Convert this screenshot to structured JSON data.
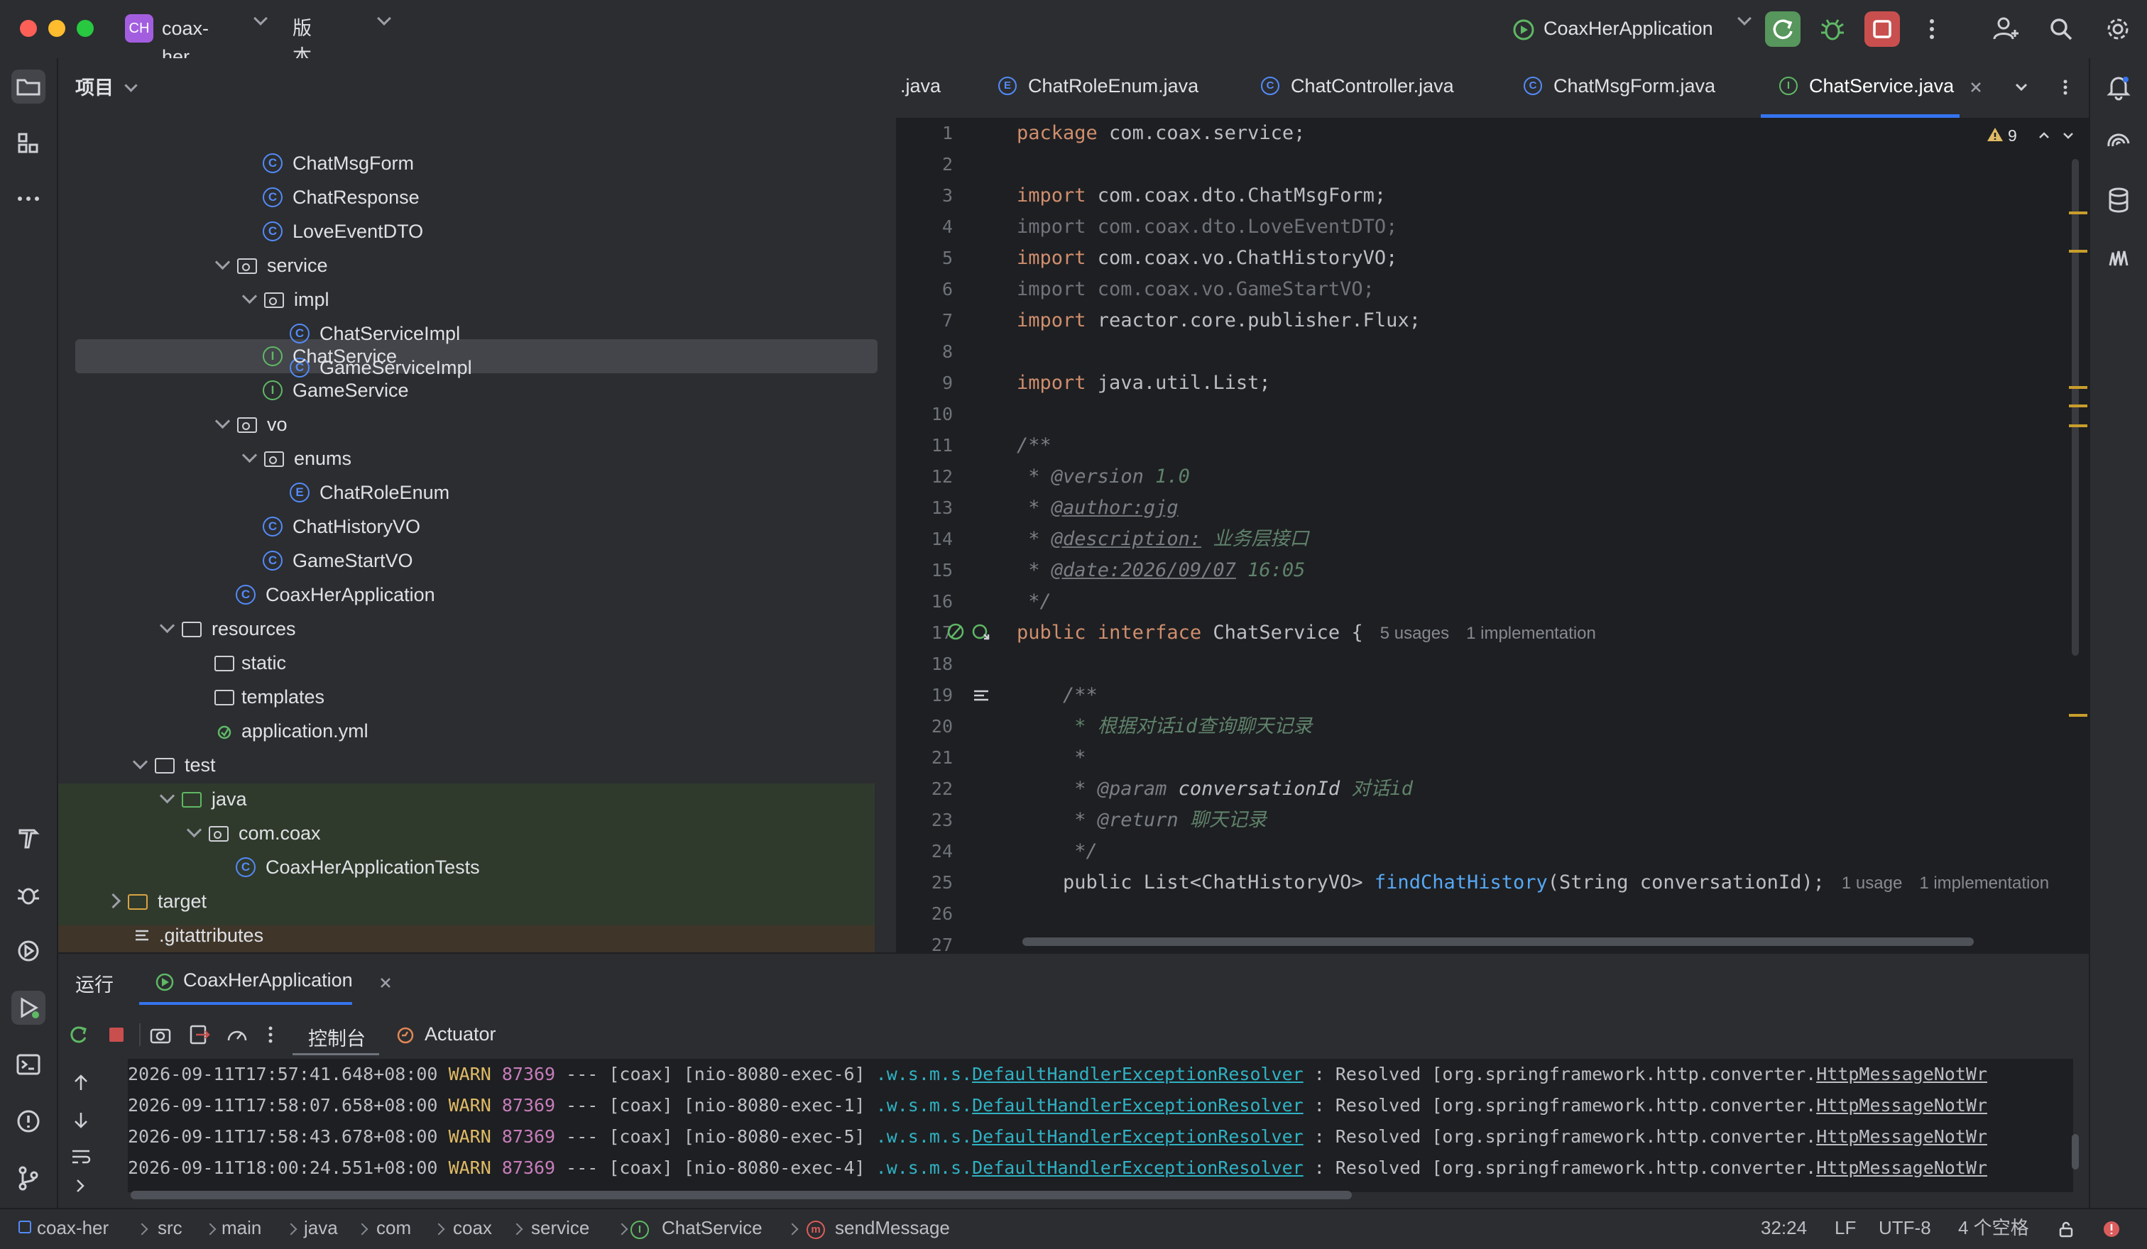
{
  "titlebar": {
    "project_badge": "CH",
    "project_name": "coax-her",
    "vcs_label": "版本控制",
    "run_config": "CoaxHerApplication"
  },
  "project_panel": {
    "title": "项目",
    "tree": [
      {
        "label": "ChatMsgForm",
        "icon": "class-icon"
      },
      {
        "label": "ChatResponse",
        "icon": "class-icon"
      },
      {
        "label": "LoveEventDTO",
        "icon": "class-icon"
      },
      {
        "label": "service",
        "icon": "package-icon"
      },
      {
        "label": "impl",
        "icon": "package-icon"
      },
      {
        "label": "ChatServiceImpl",
        "icon": "class-icon"
      },
      {
        "label": "GameServiceImpl",
        "icon": "class-icon"
      },
      {
        "label": "ChatService",
        "icon": "interface-icon",
        "selected": true
      },
      {
        "label": "GameService",
        "icon": "interface-icon"
      },
      {
        "label": "vo",
        "icon": "package-icon"
      },
      {
        "label": "enums",
        "icon": "package-icon"
      },
      {
        "label": "ChatRoleEnum",
        "icon": "enum-icon"
      },
      {
        "label": "ChatHistoryVO",
        "icon": "class-icon"
      },
      {
        "label": "GameStartVO",
        "icon": "class-icon"
      },
      {
        "label": "CoaxHerApplication",
        "icon": "spring-class-icon"
      },
      {
        "label": "resources",
        "icon": "resources-folder-icon"
      },
      {
        "label": "static",
        "icon": "folder-icon"
      },
      {
        "label": "templates",
        "icon": "folder-icon"
      },
      {
        "label": "application.yml",
        "icon": "yml-file-icon"
      },
      {
        "label": "test",
        "icon": "folder-icon"
      },
      {
        "label": "java",
        "icon": "test-source-folder-icon"
      },
      {
        "label": "com.coax",
        "icon": "package-icon"
      },
      {
        "label": "CoaxHerApplicationTests",
        "icon": "spring-class-icon"
      },
      {
        "label": "target",
        "icon": "excluded-folder-icon"
      },
      {
        "label": ".gitattributes",
        "icon": "text-file-icon"
      }
    ]
  },
  "editor": {
    "tabs": [
      {
        "label": ".java"
      },
      {
        "label": "ChatRoleEnum.java"
      },
      {
        "label": "ChatController.java"
      },
      {
        "label": "ChatMsgForm.java"
      },
      {
        "label": "ChatService.java",
        "active": true
      }
    ],
    "warning_count": "9",
    "line_numbers": [
      "1",
      "2",
      "3",
      "4",
      "5",
      "6",
      "7",
      "8",
      "9",
      "10",
      "11",
      "12",
      "13",
      "14",
      "15",
      "16",
      "17",
      "18",
      "19",
      "20",
      "21",
      "22",
      "23",
      "24",
      "25",
      "26",
      "27"
    ],
    "code": {
      "l1_kw": "package",
      "l1_rest": " com.coax.service;",
      "l3_kw": "import",
      "l3_rest": " com.coax.dto.ChatMsgForm;",
      "l4": "import com.coax.dto.LoveEventDTO;",
      "l5_kw": "import",
      "l5_rest": " com.coax.vo.ChatHistoryVO;",
      "l6": "import com.coax.vo.GameStartVO;",
      "l7_kw": "import",
      "l7_rest": " reactor.core.publisher.Flux;",
      "l9_kw": "import",
      "l9_rest": " java.util.List;",
      "l11": "/**",
      "l12_star": " * ",
      "l12_tag": "@version",
      "l12_val": " 1.0",
      "l13_star": " * ",
      "l13_tag": "@author:gjg",
      "l14_star": " * ",
      "l14_tag": "@description:",
      "l14_val": " 业务层接口",
      "l15_star": " * ",
      "l15_tag": "@date:2026/09/07",
      "l15_val": " 16:05",
      "l16": " */",
      "l17_kw1": "public",
      "l17_kw2": "interface",
      "l17_name": " ChatService {",
      "l17_usages": "5 usages",
      "l17_impl": "1 implementation",
      "l19": "    /**",
      "l20": "     * 根据对话id查询聊天记录",
      "l21": "     *",
      "l22_star": "     * ",
      "l22_tag": "@param",
      "l22_param": " conversationId",
      "l22_val": " 对话id",
      "l23_star": "     * ",
      "l23_tag": "@return",
      "l23_val": " 聊天记录",
      "l24": "     */",
      "l25_pre": "    public List<ChatHistoryVO> ",
      "l25_fn": "findChatHistory",
      "l25_post": "(String conversationId);",
      "l25_usage": "1 usage",
      "l25_impl": "1 implementation"
    }
  },
  "run_panel": {
    "title": "运行",
    "tab_label": "CoaxHerApplication",
    "console_tab": "控制台",
    "actuator_tab": "Actuator",
    "log_lines": [
      {
        "ts": "2026-09-11T17:57:41.648+08:00",
        "level": "WARN",
        "pid": "87369",
        "mid": " --- [coax] [nio-8080-exec-6] ",
        "logger_pkg": ".w.s.m.s.",
        "logger_cls": "DefaultHandlerExceptionResolver",
        "msg": " : Resolved [org.springframework.http.converter.",
        "msg_cls": "HttpMessageNotWr"
      },
      {
        "ts": "2026-09-11T17:58:07.658+08:00",
        "level": "WARN",
        "pid": "87369",
        "mid": " --- [coax] [nio-8080-exec-1] ",
        "logger_pkg": ".w.s.m.s.",
        "logger_cls": "DefaultHandlerExceptionResolver",
        "msg": " : Resolved [org.springframework.http.converter.",
        "msg_cls": "HttpMessageNotWr"
      },
      {
        "ts": "2026-09-11T17:58:43.678+08:00",
        "level": "WARN",
        "pid": "87369",
        "mid": " --- [coax] [nio-8080-exec-5] ",
        "logger_pkg": ".w.s.m.s.",
        "logger_cls": "DefaultHandlerExceptionResolver",
        "msg": " : Resolved [org.springframework.http.converter.",
        "msg_cls": "HttpMessageNotWr"
      },
      {
        "ts": "2026-09-11T18:00:24.551+08:00",
        "level": "WARN",
        "pid": "87369",
        "mid": " --- [coax] [nio-8080-exec-4] ",
        "logger_pkg": ".w.s.m.s.",
        "logger_cls": "DefaultHandlerExceptionResolver",
        "msg": " : Resolved [org.springframework.http.converter.",
        "msg_cls": "HttpMessageNotWr"
      }
    ]
  },
  "statusbar": {
    "breadcrumbs": [
      "coax-her",
      "src",
      "main",
      "java",
      "com",
      "coax",
      "service",
      "ChatService",
      "sendMessage"
    ],
    "position": "32:24",
    "line_sep": "LF",
    "encoding": "UTF-8",
    "indent": "4 个空格"
  },
  "colors": {
    "accent": "#3574f0",
    "run_green": "#57965c",
    "stop_red": "#c94f4f",
    "warning_yellow": "#e0bb65"
  }
}
